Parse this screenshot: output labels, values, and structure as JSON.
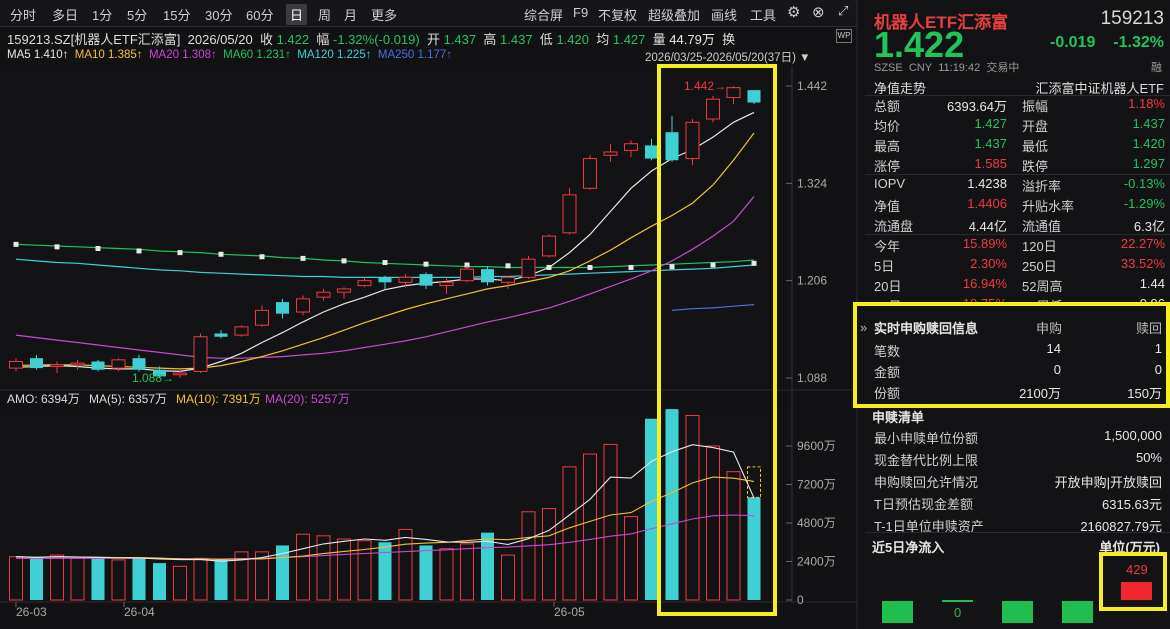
{
  "toolbar": {
    "items": [
      "分时",
      "多日",
      "1分",
      "5分",
      "15分",
      "30分",
      "60分",
      "日",
      "周",
      "月",
      "更多"
    ],
    "selected": "日",
    "right": [
      "综合屏",
      "F9",
      "不复权",
      "超级叠加",
      "画线",
      "工具"
    ]
  },
  "chart_header": {
    "code": "159213.SZ[机器人ETF汇添富]",
    "date": "2026/05/20",
    "close_label": "收",
    "close": "1.422",
    "chg_label": "幅",
    "chg": "-1.32%(-0.019)",
    "open_label": "开",
    "open": "1.437",
    "high_label": "高",
    "high": "1.437",
    "low_label": "低",
    "low": "1.420",
    "avg_label": "均",
    "avg": "1.427",
    "vol_label": "量",
    "vol": "44.79万",
    "turn_label": "换"
  },
  "ma_line": {
    "ma5": "MA5",
    "ma5_v": "1.410↑",
    "ma10": "MA10",
    "ma10_v": "1.385↑",
    "ma20": "MA20",
    "ma20_v": "1.308↑",
    "ma60": "MA60",
    "ma60_v": "1.231↑",
    "ma120": "MA120",
    "ma120_v": "1.225↑",
    "ma250": "MA250",
    "ma250_v": "1.177↑"
  },
  "range": "2026/03/25-2026/05/20(37日)",
  "vol_header": {
    "amo": "AMO: 6394万",
    "ma5": "MA(5): 6357万",
    "ma10": "MA(10): 7391万",
    "ma20": "MA(20): 5257万"
  },
  "price_axis": [
    "1.442",
    "1.324",
    "1.206",
    "1.088"
  ],
  "vol_axis": [
    "9600万",
    "7200万",
    "4800万",
    "2400万",
    "0"
  ],
  "date_axis": [
    "26-03",
    "26-04",
    "26-05"
  ],
  "annotations": {
    "high": "1.442",
    "low": "1.088"
  },
  "colors": {
    "up": "#f2383f",
    "down": "#3fd0d4",
    "ma5": "#e8e8e8",
    "ma10": "#f1c232",
    "ma20": "#c74bd3",
    "ma60": "#21c45a",
    "ma120": "#3fd0d4",
    "ma250": "#4a6ee0",
    "highlight": "#f5ef1e"
  },
  "chart_data": {
    "type": "candlestick",
    "ohlc": [
      [
        1.1,
        1.112,
        1.096,
        1.108
      ],
      [
        1.112,
        1.116,
        1.098,
        1.1
      ],
      [
        1.102,
        1.108,
        1.094,
        1.104
      ],
      [
        1.104,
        1.11,
        1.098,
        1.106
      ],
      [
        1.108,
        1.11,
        1.096,
        1.098
      ],
      [
        1.1,
        1.112,
        1.096,
        1.11
      ],
      [
        1.112,
        1.116,
        1.096,
        1.098
      ],
      [
        1.098,
        1.102,
        1.088,
        1.09
      ],
      [
        1.092,
        1.098,
        1.088,
        1.094
      ],
      [
        1.096,
        1.142,
        1.094,
        1.138
      ],
      [
        1.142,
        1.146,
        1.136,
        1.138
      ],
      [
        1.14,
        1.152,
        1.138,
        1.15
      ],
      [
        1.152,
        1.176,
        1.15,
        1.17
      ],
      [
        1.18,
        1.184,
        1.16,
        1.166
      ],
      [
        1.168,
        1.188,
        1.164,
        1.184
      ],
      [
        1.186,
        1.196,
        1.182,
        1.192
      ],
      [
        1.192,
        1.198,
        1.184,
        1.196
      ],
      [
        1.2,
        1.21,
        1.198,
        1.206
      ],
      [
        1.21,
        1.212,
        1.196,
        1.204
      ],
      [
        1.204,
        1.214,
        1.198,
        1.21
      ],
      [
        1.214,
        1.216,
        1.196,
        1.2
      ],
      [
        1.2,
        1.21,
        1.19,
        1.204
      ],
      [
        1.206,
        1.224,
        1.204,
        1.22
      ],
      [
        1.22,
        1.224,
        1.2,
        1.204
      ],
      [
        1.204,
        1.212,
        1.196,
        1.21
      ],
      [
        1.21,
        1.236,
        1.208,
        1.232
      ],
      [
        1.236,
        1.262,
        1.234,
        1.26
      ],
      [
        1.264,
        1.318,
        1.262,
        1.31
      ],
      [
        1.318,
        1.358,
        1.316,
        1.354
      ],
      [
        1.358,
        1.372,
        1.35,
        1.362
      ],
      [
        1.364,
        1.376,
        1.356,
        1.372
      ],
      [
        1.37,
        1.378,
        1.352,
        1.354
      ],
      [
        1.386,
        1.406,
        1.35,
        1.352
      ],
      [
        1.354,
        1.402,
        1.346,
        1.398
      ],
      [
        1.402,
        1.43,
        1.398,
        1.426
      ],
      [
        1.428,
        1.442,
        1.42,
        1.44
      ],
      [
        1.437,
        1.437,
        1.42,
        1.422
      ]
    ],
    "volume_wan": [
      2700,
      2600,
      2800,
      2600,
      2600,
      2500,
      2600,
      2300,
      2100,
      2600,
      2500,
      3000,
      3000,
      3400,
      4100,
      4000,
      3800,
      3700,
      3600,
      4400,
      3400,
      3200,
      3500,
      4200,
      2800,
      5500,
      5700,
      8300,
      9100,
      9700,
      5200,
      11300,
      11900,
      11500,
      9600,
      8000,
      6394
    ],
    "ma5": [
      1.101,
      1.102,
      1.103,
      1.102,
      1.1,
      1.099,
      1.099,
      1.097,
      1.096,
      1.1,
      1.108,
      1.118,
      1.131,
      1.143,
      1.156,
      1.168,
      1.178,
      1.186,
      1.195,
      1.2,
      1.203,
      1.205,
      1.208,
      1.208,
      1.206,
      1.212,
      1.222,
      1.24,
      1.262,
      1.29,
      1.318,
      1.339,
      1.354,
      1.365,
      1.38,
      1.398,
      1.41
    ],
    "ma10": [
      1.103,
      1.104,
      1.104,
      1.104,
      1.103,
      1.102,
      1.101,
      1.1,
      1.099,
      1.1,
      1.103,
      1.108,
      1.114,
      1.121,
      1.129,
      1.137,
      1.146,
      1.155,
      1.163,
      1.171,
      1.178,
      1.184,
      1.19,
      1.196,
      1.2,
      1.205,
      1.21,
      1.218,
      1.23,
      1.243,
      1.258,
      1.272,
      1.285,
      1.3,
      1.322,
      1.352,
      1.385
    ],
    "ma20": [
      1.14,
      1.137,
      1.134,
      1.131,
      1.128,
      1.125,
      1.122,
      1.119,
      1.116,
      1.113,
      1.112,
      1.112,
      1.113,
      1.114,
      1.116,
      1.118,
      1.121,
      1.125,
      1.129,
      1.133,
      1.138,
      1.144,
      1.15,
      1.156,
      1.161,
      1.167,
      1.173,
      1.181,
      1.19,
      1.199,
      1.208,
      1.218,
      1.23,
      1.244,
      1.26,
      1.278,
      1.308
    ],
    "ma60": [
      1.25,
      1.249,
      1.248,
      1.247,
      1.246,
      1.245,
      1.244,
      1.242,
      1.241,
      1.24,
      1.238,
      1.237,
      1.236,
      1.234,
      1.233,
      1.231,
      1.23,
      1.228,
      1.227,
      1.226,
      1.225,
      1.224,
      1.223,
      1.223,
      1.222,
      1.222,
      1.222,
      1.222,
      1.222,
      1.223,
      1.224,
      1.225,
      1.226,
      1.227,
      1.228,
      1.229,
      1.231
    ],
    "ma120": [
      1.232,
      1.23,
      1.228,
      1.227,
      1.225,
      1.223,
      1.221,
      1.219,
      1.218,
      1.216,
      1.215,
      1.214,
      1.213,
      1.212,
      1.211,
      1.211,
      1.21,
      1.21,
      1.21,
      1.21,
      1.21,
      1.21,
      1.21,
      1.211,
      1.211,
      1.212,
      1.213,
      1.214,
      1.215,
      1.216,
      1.217,
      1.218,
      1.219,
      1.22,
      1.221,
      1.223,
      1.225
    ],
    "ma250_from_index": 32,
    "ma250": [
      1.17,
      1.172,
      1.173,
      1.175,
      1.177
    ],
    "ma60_marks": [
      1.25,
      1.247,
      1.245,
      1.242,
      1.24,
      1.238,
      1.235,
      1.233,
      1.23,
      1.228,
      1.226,
      1.225,
      1.224,
      1.222,
      1.222,
      1.222,
      1.223,
      1.225,
      1.227
    ],
    "vol_ma5": [
      2700,
      2650,
      2700,
      2675,
      2660,
      2620,
      2620,
      2560,
      2520,
      2520,
      2420,
      2500,
      2640,
      2900,
      3200,
      3500,
      3660,
      3800,
      3720,
      3900,
      3780,
      3620,
      3600,
      3660,
      3460,
      3820,
      4340,
      5300,
      6280,
      7660,
      7600,
      8640,
      9240,
      9680,
      9500,
      9220,
      6357
    ],
    "vol_ma10": [
      2700,
      2670,
      2700,
      2680,
      2660,
      2650,
      2650,
      2610,
      2560,
      2550,
      2530,
      2550,
      2560,
      2640,
      2740,
      2890,
      3030,
      3150,
      3300,
      3480,
      3550,
      3600,
      3700,
      3800,
      3760,
      3900,
      4000,
      4500,
      4900,
      5300,
      5450,
      6150,
      6690,
      7300,
      7660,
      7590,
      7391
    ],
    "vol_ma20": [
      2600,
      2600,
      2600,
      2600,
      2600,
      2610,
      2600,
      2590,
      2580,
      2570,
      2560,
      2580,
      2600,
      2640,
      2700,
      2770,
      2840,
      2900,
      2960,
      3020,
      3080,
      3130,
      3200,
      3260,
      3300,
      3370,
      3450,
      3600,
      3780,
      3980,
      4120,
      4450,
      4750,
      5050,
      5250,
      5300,
      5257
    ]
  },
  "right_panel": {
    "name": "机器人ETF汇添富",
    "code": "159213",
    "price": "1.422",
    "change": "-0.019",
    "change_pct": "-1.32%",
    "market": "SZSE",
    "currency": "CNY",
    "time": "11:19:42",
    "status": "交易中",
    "margin": "融",
    "nav_trend": "净值走势",
    "fund_name": "汇添富中证机器人ETF",
    "stats": [
      [
        "总额",
        "6393.64万",
        "振幅",
        "1.18%"
      ],
      [
        "均价",
        "1.427",
        "开盘",
        "1.437"
      ],
      [
        "最高",
        "1.437",
        "最低",
        "1.420"
      ],
      [
        "涨停",
        "1.585",
        "跌停",
        "1.297"
      ]
    ],
    "stats2": [
      [
        "IOPV",
        "1.4238",
        "溢折率",
        "-0.13%"
      ],
      [
        "净值",
        "1.4406",
        "升贴水率",
        "-1.29%"
      ],
      [
        "流通盘",
        "4.44亿",
        "流通值",
        "6.3亿"
      ]
    ],
    "perf": [
      [
        "今年",
        "15.89%",
        "120日",
        "22.27%"
      ],
      [
        "5日",
        "2.30%",
        "250日",
        "33.52%"
      ],
      [
        "20日",
        "16.94%",
        "52周高",
        "1.44"
      ],
      [
        "60日",
        "19.75%",
        "52周低",
        "0.96"
      ]
    ],
    "sub": {
      "title": "实时申购赎回信息",
      "h1": "申购",
      "h2": "赎回",
      "rows": [
        [
          "笔数",
          "14",
          "1"
        ],
        [
          "金额",
          "0",
          "0"
        ],
        [
          "份额",
          "2100万",
          "150万"
        ]
      ]
    },
    "list": {
      "title": "申赎清单",
      "rows": [
        [
          "最小申赎单位份额",
          "1,500,000"
        ],
        [
          "现金替代比例上限",
          "50%"
        ],
        [
          "申购赎回允许情况",
          "开放申购|开放赎回"
        ],
        [
          "T日预估现金差额",
          "6315.63元"
        ],
        [
          "T-1日单位申赎资产",
          "2160827.79元"
        ]
      ]
    },
    "flow": {
      "title": "近5日净流入",
      "unit": "单位(万元)",
      "values": [
        "",
        "0",
        "",
        "",
        "429"
      ]
    }
  }
}
